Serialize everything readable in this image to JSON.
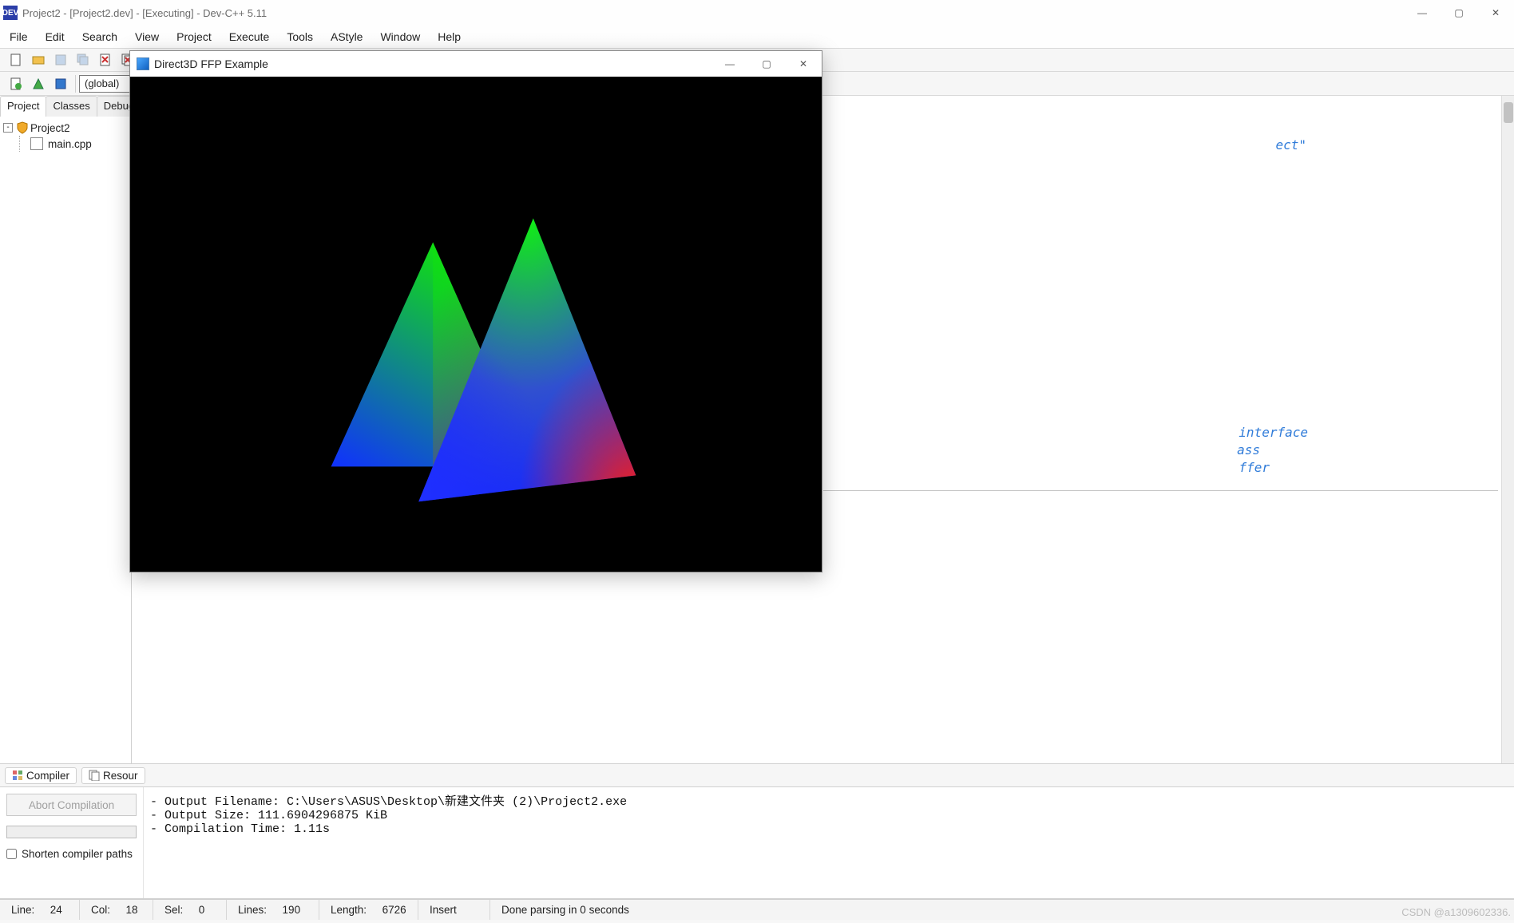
{
  "window": {
    "title": "Project2 - [Project2.dev] - [Executing] - Dev-C++ 5.11",
    "min": "—",
    "max": "▢",
    "close": "✕"
  },
  "menu": {
    "items": [
      "File",
      "Edit",
      "Search",
      "View",
      "Project",
      "Execute",
      "Tools",
      "AStyle",
      "Window",
      "Help"
    ]
  },
  "toolbar2": {
    "combo": "(global)"
  },
  "left_panel": {
    "tabs": [
      "Project",
      "Classes",
      "Debug"
    ],
    "project_name": "Project2",
    "file_name": "main.cpp"
  },
  "editor_fragments": {
    "f1": "ect\"",
    "f2": "interface",
    "f3": "ass",
    "f4": "ffer"
  },
  "bottom_tabs": {
    "compiler": "Compiler",
    "resources": "Resour"
  },
  "compiler_side": {
    "abort": "Abort Compilation",
    "shorten": "Shorten compiler paths"
  },
  "compiler_output": "- Output Filename: C:\\Users\\ASUS\\Desktop\\新建文件夹 (2)\\Project2.exe\n- Output Size: 111.6904296875 KiB\n- Compilation Time: 1.11s",
  "status": {
    "line_label": "Line:",
    "line_value": "24",
    "col_label": "Col:",
    "col_value": "18",
    "sel_label": "Sel:",
    "sel_value": "0",
    "lines_label": "Lines:",
    "lines_value": "190",
    "length_label": "Length:",
    "length_value": "6726",
    "insert": "Insert",
    "done": "Done parsing in 0 seconds"
  },
  "watermark": "CSDN @a1309602336.",
  "d3d": {
    "title": "Direct3D FFP Example",
    "min": "—",
    "max": "▢",
    "close": "✕"
  }
}
